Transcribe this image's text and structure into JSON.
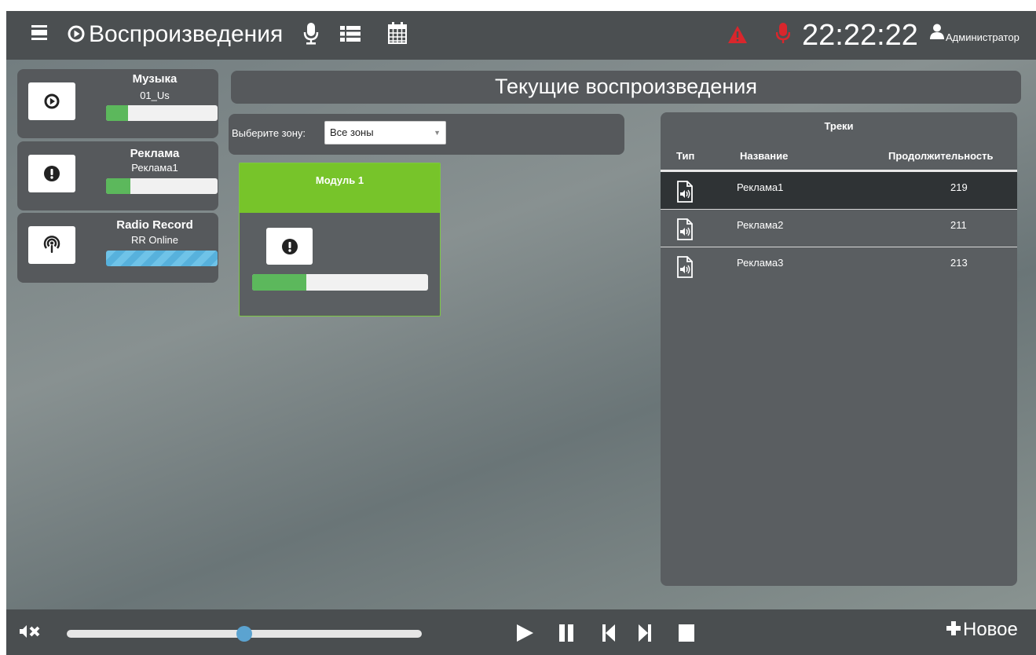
{
  "topbar": {
    "title": "Воспроизведения",
    "clock": "22:22:22",
    "user": "Администратор",
    "icons": [
      "menu-icon",
      "play-circle-icon",
      "microphone-icon",
      "list-icon",
      "calendar-icon",
      "alert-triangle-icon",
      "recording-mic-icon",
      "user-icon"
    ],
    "alert_color": "#d9262c"
  },
  "sources": [
    {
      "name": "Музыка",
      "track": "01_Us",
      "icon": "play-circle-icon",
      "progress": 0.2
    },
    {
      "name": "Реклама",
      "track": "Реклама1",
      "icon": "exclamation-circle-icon",
      "progress": 0.22
    },
    {
      "name": "Radio Record",
      "track": "RR Online",
      "icon": "podcast-icon",
      "progress": 1.0,
      "streaming": true
    }
  ],
  "page_title": "Текущие воспроизведения",
  "zone": {
    "label": "Выберите зону:",
    "selected": "Все зоны"
  },
  "module": {
    "title": "Модуль 1",
    "icon": "exclamation-circle-icon",
    "progress": 0.31,
    "accent": "#77c42a"
  },
  "tracks": {
    "header": "Треки",
    "columns": [
      "Тип",
      "Название",
      "Продолжительность"
    ],
    "rows": [
      {
        "type_icon": "audio-file-icon",
        "name": "Реклама1",
        "duration": "219",
        "selected": true
      },
      {
        "type_icon": "audio-file-icon",
        "name": "Реклама2",
        "duration": "211",
        "selected": false
      },
      {
        "type_icon": "audio-file-icon",
        "name": "Реклама3",
        "duration": "213",
        "selected": false
      }
    ]
  },
  "player": {
    "volume": 0.5,
    "controls": [
      "play-icon",
      "pause-icon",
      "skip-back-icon",
      "skip-forward-icon",
      "stop-icon"
    ],
    "new_label": "Новое"
  }
}
